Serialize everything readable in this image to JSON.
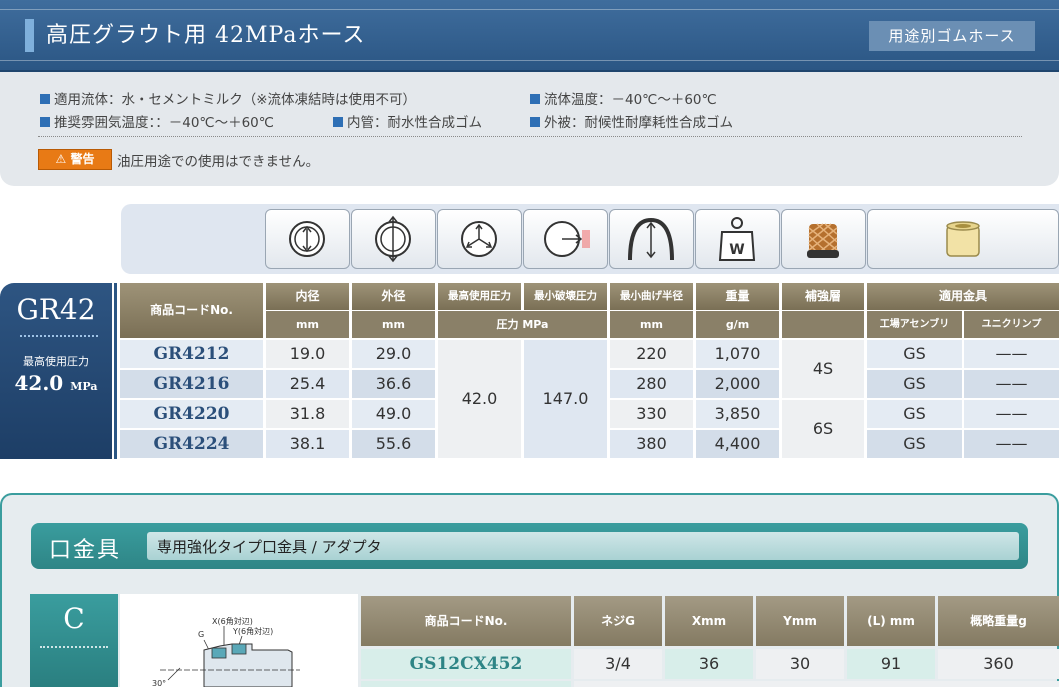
{
  "header": {
    "title": "高圧グラウト用 42MPaホース",
    "category": "用途別ゴムホース"
  },
  "spec": {
    "fluid": "適用流体：水・セメントミルク（※流体凍結時は使用不可）",
    "fluid_temp": "流体温度：－40℃～＋60℃",
    "ambient_temp": "推奨雰囲気温度：：－40℃～＋60℃",
    "inner_tube": "内管：耐水性合成ゴム",
    "cover": "外被：耐候性耐摩耗性合成ゴム",
    "warning_badge": "警告",
    "warning_text": "油圧用途での使用はできません。"
  },
  "icons": [
    "inner-diameter-icon",
    "outer-diameter-icon",
    "working-pressure-icon",
    "burst-pressure-icon",
    "bend-radius-icon",
    "weight-icon",
    "reinforcement-icon",
    "fitting-icon"
  ],
  "series": {
    "code": "GR42",
    "pressure_label": "最高使用圧力",
    "pressure_value": "42.0",
    "pressure_unit": "MPa"
  },
  "table": {
    "headers": {
      "code": "商品コードNo.",
      "id": "内径",
      "od": "外径",
      "wp": "最高使用圧力",
      "bp": "最小破壊圧力",
      "br": "最小曲げ半径",
      "wt": "重量",
      "rf": "補強層",
      "fit": "適用金具"
    },
    "units": {
      "id": "mm",
      "od": "mm",
      "pressure": "圧力 MPa",
      "br": "mm",
      "wt": "g/m",
      "fit_a": "工場アセンブリ",
      "fit_b": "ユニクリンプ"
    },
    "working_pressure": "42.0",
    "burst_pressure": "147.0",
    "reinforcement": [
      "4S",
      "6S"
    ],
    "rows": [
      {
        "code": "GR4212",
        "id": "19.0",
        "od": "29.0",
        "br": "220",
        "wt": "1,070",
        "fa": "GS",
        "fb": "——"
      },
      {
        "code": "GR4216",
        "id": "25.4",
        "od": "36.6",
        "br": "280",
        "wt": "2,000",
        "fa": "GS",
        "fb": "——"
      },
      {
        "code": "GR4220",
        "id": "31.8",
        "od": "49.0",
        "br": "330",
        "wt": "3,850",
        "fa": "GS",
        "fb": "——"
      },
      {
        "code": "GR4224",
        "id": "38.1",
        "od": "55.6",
        "br": "380",
        "wt": "4,400",
        "fa": "GS",
        "fb": "——"
      }
    ]
  },
  "fittings": {
    "title": "口金具",
    "subtitle": "専用強化タイプ口金具 / アダプタ",
    "type": "C",
    "drawing_labels": {
      "x": "X(6角対辺)",
      "y": "Y(6角対辺)",
      "g": "G",
      "angle": "30°"
    },
    "headers": {
      "code": "商品コードNo.",
      "thread": "ネジG",
      "x": "Xmm",
      "y": "Ymm",
      "l": "(L) mm",
      "weight": "概略重量g"
    },
    "rows": [
      {
        "code": "GS12CX452",
        "thread": "3/4",
        "x": "36",
        "y": "30",
        "l": "91",
        "weight": "360"
      }
    ]
  }
}
